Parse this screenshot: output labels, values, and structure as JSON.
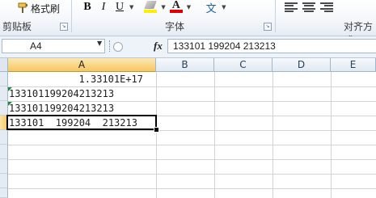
{
  "ribbon": {
    "format_painter_label": "格式刷",
    "font_buttons": {
      "bold": "B",
      "italic": "I",
      "underline": "U"
    },
    "font_color_glyph": "A",
    "wen_glyph": "文",
    "groups": {
      "clipboard": "剪贴板",
      "font": "字体",
      "alignment": "对齐方式"
    },
    "colors": {
      "highlight": "#ffee00",
      "font_color": "#e00000"
    }
  },
  "formula_bar": {
    "name_box": "A4",
    "fx_label": "fx",
    "content": "133101  199204  213213"
  },
  "sheet": {
    "columns": [
      "A",
      "B",
      "C",
      "D",
      "E"
    ],
    "selected_column": "A",
    "cells": {
      "A1": "1.33101E+17",
      "A2": "133101199204213213",
      "A3": "133101199204213213",
      "A4": "133101  199204  213213"
    },
    "active_cell": "A4",
    "error_indicator_color": "#1e8a3c"
  }
}
